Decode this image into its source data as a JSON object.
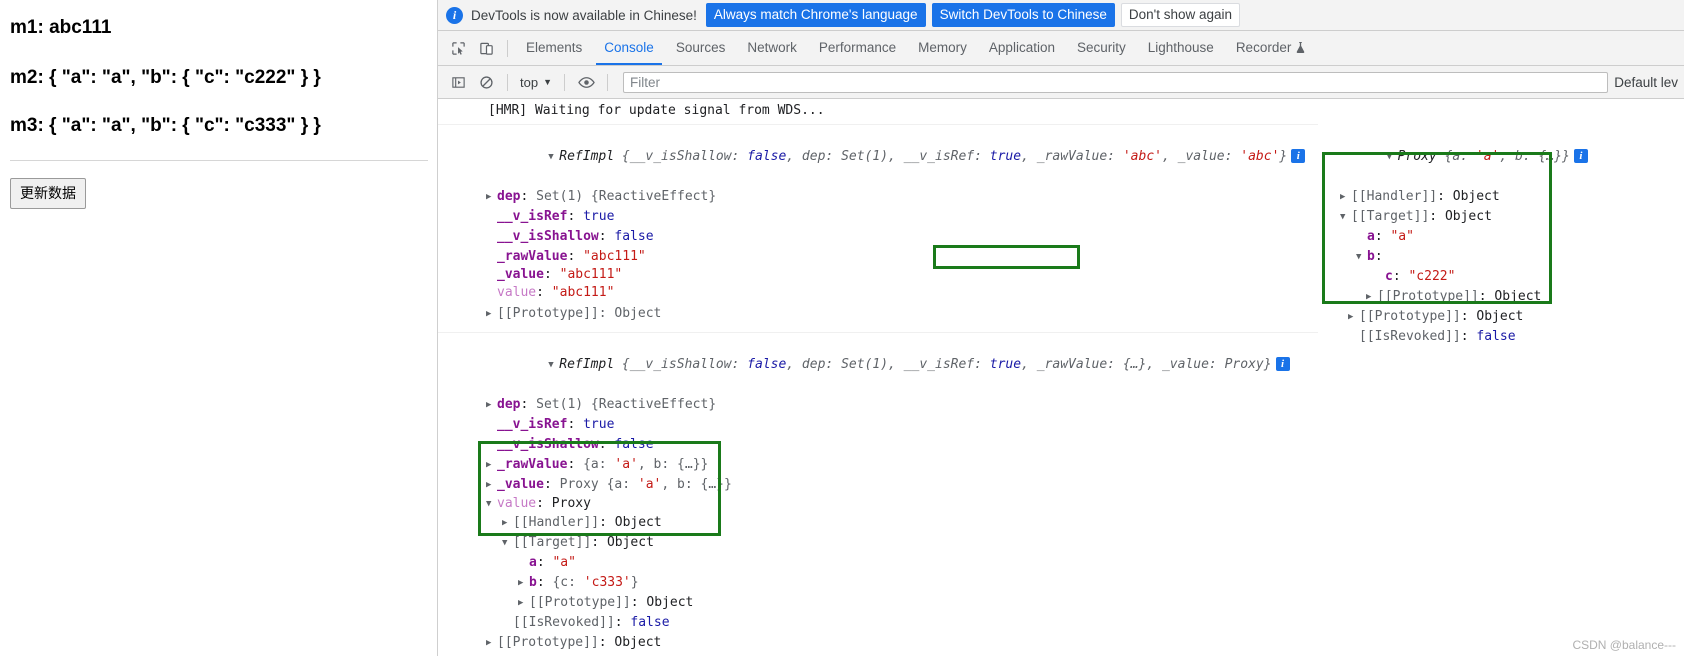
{
  "page": {
    "lines": [
      {
        "id": "m1",
        "text": "m1: abc111"
      },
      {
        "id": "m2",
        "text": "m2: { \"a\": \"a\", \"b\": { \"c\": \"c222\" } }"
      },
      {
        "id": "m3",
        "text": "m3: { \"a\": \"a\", \"b\": { \"c\": \"c333\" } }"
      }
    ],
    "refresh_button": "更新数据"
  },
  "devtools": {
    "banner": {
      "icon": "info-icon",
      "message": "DevTools is now available in Chinese!",
      "primary_button": "Always match Chrome's language",
      "secondary_button": "Switch DevTools to Chinese",
      "dismiss_button": "Don't show again"
    },
    "tabs": [
      {
        "label": "Elements",
        "active": false
      },
      {
        "label": "Console",
        "active": true
      },
      {
        "label": "Sources",
        "active": false
      },
      {
        "label": "Network",
        "active": false
      },
      {
        "label": "Performance",
        "active": false
      },
      {
        "label": "Memory",
        "active": false
      },
      {
        "label": "Application",
        "active": false
      },
      {
        "label": "Security",
        "active": false
      },
      {
        "label": "Lighthouse",
        "active": false
      },
      {
        "label": "Recorder",
        "active": false,
        "badge": "flask-icon"
      }
    ],
    "toolbar_icons": [
      "inspect-element-icon",
      "device-toolbar-icon"
    ],
    "console_toolbar": {
      "execute_icon": "execute-sidebar-icon",
      "clear_icon": "clear-console-icon",
      "context": "top",
      "context_caret": "chevron-down-icon",
      "eye_icon": "live-expression-icon",
      "filter_placeholder": "Filter",
      "filter_value": "",
      "level": "Default lev"
    }
  },
  "console": {
    "hmr_message": "[HMR] Waiting for update signal from WDS...",
    "entry1": {
      "header": {
        "class": "RefImpl",
        "preview": "{__v_isShallow: false, dep: Set(1), __v_isRef: true, _rawValue: 'abc', _value: 'abc'}",
        "parts": [
          {
            "t": "{__v_isShallow: ",
            "k": "dim"
          },
          {
            "t": "false",
            "k": "bool"
          },
          {
            "t": ", dep: Set(1), __v_isRef: ",
            "k": "dim"
          },
          {
            "t": "true",
            "k": "bool"
          },
          {
            "t": ", _rawValue: ",
            "k": "dim"
          },
          {
            "t": "'abc'",
            "k": "str"
          },
          {
            "t": ", _value: ",
            "k": "dim"
          },
          {
            "t": "'abc'",
            "k": "str"
          },
          {
            "t": "}",
            "k": "dim"
          }
        ],
        "info_badge": "i"
      },
      "props": [
        {
          "arrow": "closed",
          "name": "dep",
          "sep": ": ",
          "value": "Set(1) {ReactiveEffect}",
          "vclass": "dim",
          "indent": 1
        },
        {
          "arrow": "none",
          "name": "__v_isRef",
          "sep": ": ",
          "value": "true",
          "vclass": "bool",
          "indent": 1
        },
        {
          "arrow": "none",
          "name": "__v_isShallow",
          "sep": ": ",
          "value": "false",
          "vclass": "bool",
          "indent": 1
        },
        {
          "arrow": "none",
          "name": "_rawValue",
          "sep": ": ",
          "value": "\"abc111\"",
          "vclass": "str",
          "indent": 1
        },
        {
          "arrow": "none",
          "name": "_value",
          "sep": ": ",
          "value": "\"abc111\"",
          "vclass": "str",
          "indent": 1
        },
        {
          "arrow": "none",
          "name": "value",
          "sep": ": ",
          "value": "\"abc111\"",
          "vclass": "str",
          "indent": 1,
          "accessor": true,
          "highlight": true
        },
        {
          "arrow": "closed",
          "name": "[[Prototype]]",
          "sep": ": ",
          "value": "Object",
          "vclass": "dim",
          "indent": 1,
          "dimname": true
        }
      ]
    },
    "entry1_right": {
      "header": {
        "class": "Proxy",
        "parts": [
          {
            "t": "{a: ",
            "k": "dim"
          },
          {
            "t": "'a'",
            "k": "str"
          },
          {
            "t": ", b: {…}}",
            "k": "dim"
          }
        ],
        "info_badge": "i"
      },
      "props": [
        {
          "arrow": "closed",
          "name": "[[Handler]]",
          "sep": ": ",
          "value": "Object",
          "vclass": "plain",
          "indent": 1,
          "dimname": true
        },
        {
          "arrow": "open",
          "name": "[[Target]]",
          "sep": ": ",
          "value": "Object",
          "vclass": "plain",
          "indent": 1,
          "dimname": true
        },
        {
          "arrow": "none",
          "name": "a",
          "sep": ": ",
          "value": "\"a\"",
          "vclass": "str",
          "indent": 2
        },
        {
          "arrow": "open",
          "name": "b",
          "sep": ":",
          "value": "",
          "vclass": "plain",
          "indent": 2
        },
        {
          "arrow": "none",
          "name": "c",
          "sep": ": ",
          "value": "\"c222\"",
          "vclass": "str",
          "indent": 3
        },
        {
          "arrow": "closed",
          "name": "[[Prototype]]",
          "sep": ": ",
          "value": "Object",
          "vclass": "plain",
          "indent": 3,
          "dimname": true
        },
        {
          "arrow": "closed",
          "name": "[[Prototype]]",
          "sep": ": ",
          "value": "Object",
          "vclass": "plain",
          "indent": 1,
          "dimname": true
        },
        {
          "arrow": "none",
          "name": "[[IsRevoked]]",
          "sep": ": ",
          "value": "false",
          "vclass": "bool",
          "indent": 1,
          "dimname": true
        }
      ]
    },
    "entry2": {
      "header": {
        "class": "RefImpl",
        "parts": [
          {
            "t": "{__v_isShallow: ",
            "k": "dim"
          },
          {
            "t": "false",
            "k": "bool"
          },
          {
            "t": ", dep: Set(1), __v_isRef: ",
            "k": "dim"
          },
          {
            "t": "true",
            "k": "bool"
          },
          {
            "t": ", _rawValue: {…}, _value: Proxy}",
            "k": "dim"
          }
        ],
        "info_badge": "i"
      },
      "props": [
        {
          "arrow": "closed",
          "name": "dep",
          "sep": ": ",
          "value": "Set(1) {ReactiveEffect}",
          "vclass": "dim",
          "indent": 1
        },
        {
          "arrow": "none",
          "name": "__v_isRef",
          "sep": ": ",
          "value": "true",
          "vclass": "bool",
          "indent": 1
        },
        {
          "arrow": "none",
          "name": "__v_isShallow",
          "sep": ": ",
          "value": "false",
          "vclass": "bool",
          "indent": 1
        },
        {
          "arrow": "closed",
          "name": "_rawValue",
          "sep": ": ",
          "value": "{a: 'a', b: {…}}",
          "vclass": "objprev",
          "indent": 1
        },
        {
          "arrow": "closed",
          "name": "_value",
          "sep": ": ",
          "value": "Proxy {a: 'a', b: {…}}",
          "vclass": "objprev",
          "indent": 1
        },
        {
          "arrow": "open",
          "name": "value",
          "sep": ": ",
          "value": "Proxy",
          "vclass": "plain",
          "indent": 1,
          "accessor": true,
          "highlight": true
        },
        {
          "arrow": "closed",
          "name": "[[Handler]]",
          "sep": ": ",
          "value": "Object",
          "vclass": "plain",
          "indent": 2,
          "dimname": true,
          "highlight": true
        },
        {
          "arrow": "open",
          "name": "[[Target]]",
          "sep": ": ",
          "value": "Object",
          "vclass": "plain",
          "indent": 2,
          "dimname": true,
          "highlight": true
        },
        {
          "arrow": "none",
          "name": "a",
          "sep": ": ",
          "value": "\"a\"",
          "vclass": "str",
          "indent": 3,
          "highlight": true
        },
        {
          "arrow": "closed",
          "name": "b",
          "sep": ": ",
          "value": "{c: 'c333'}",
          "vclass": "objprev",
          "indent": 3,
          "highlight": true
        },
        {
          "arrow": "closed",
          "name": "[[Prototype]]",
          "sep": ": ",
          "value": "Object",
          "vclass": "plain",
          "indent": 3,
          "dimname": true
        },
        {
          "arrow": "none",
          "name": "[[IsRevoked]]",
          "sep": ": ",
          "value": "false",
          "vclass": "bool",
          "indent": 2,
          "dimname": true
        },
        {
          "arrow": "closed",
          "name": "[[Prototype]]",
          "sep": ": ",
          "value": "Object",
          "vclass": "plain",
          "indent": 1,
          "dimname": true
        }
      ]
    }
  },
  "watermark": "CSDN @balance---",
  "colors": {
    "accent": "#1a73e8",
    "highlight_box": "#1a7a1a",
    "string": "#c41a16",
    "keyword": "#1a1aa6",
    "property": "#881391",
    "accessor": "#c679c6"
  }
}
